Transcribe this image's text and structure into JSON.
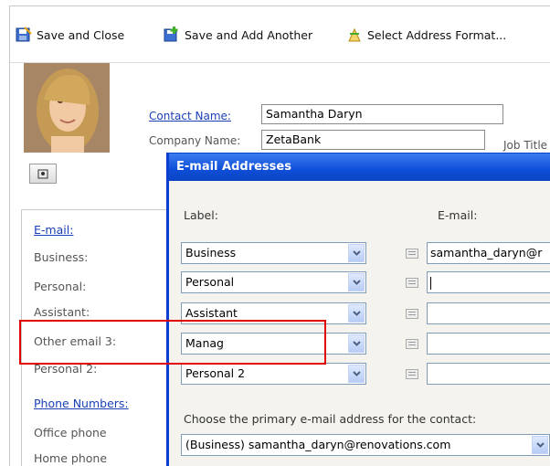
{
  "toolbar": {
    "save_close": "Save and Close",
    "save_add": "Save and Add Another",
    "select_address": "Select Address Format..."
  },
  "contact": {
    "name_label": "Contact Name:",
    "name_value": "Samantha Daryn",
    "company_label": "Company Name:",
    "company_value": "ZetaBank",
    "job_title_label": "Job Title"
  },
  "left_panel": {
    "email_header": "E-mail:",
    "business": "Business:",
    "personal": "Personal:",
    "assistant": "Assistant:",
    "other3": "Other email 3:",
    "personal2": "Personal 2:",
    "phone_header": "Phone Numbers:",
    "office": "Office phone",
    "home": "Home phone"
  },
  "dialog": {
    "title": "E-mail Addresses",
    "label_header": "Label:",
    "email_header": "E-mail:",
    "rows": [
      {
        "label": "Business",
        "email": "samantha_daryn@r"
      },
      {
        "label": "Personal",
        "email": ""
      },
      {
        "label": "Assistant",
        "email": ""
      },
      {
        "label": "Manag",
        "email": ""
      },
      {
        "label": "Personal 2",
        "email": ""
      }
    ],
    "primary_prompt": "Choose the primary e-mail address for the contact:",
    "primary_value": "(Business) samantha_daryn@renovations.com"
  },
  "colors": {
    "title_bar": "#0e4ed8",
    "highlight": "#e00000",
    "link": "#1a3fb6"
  }
}
